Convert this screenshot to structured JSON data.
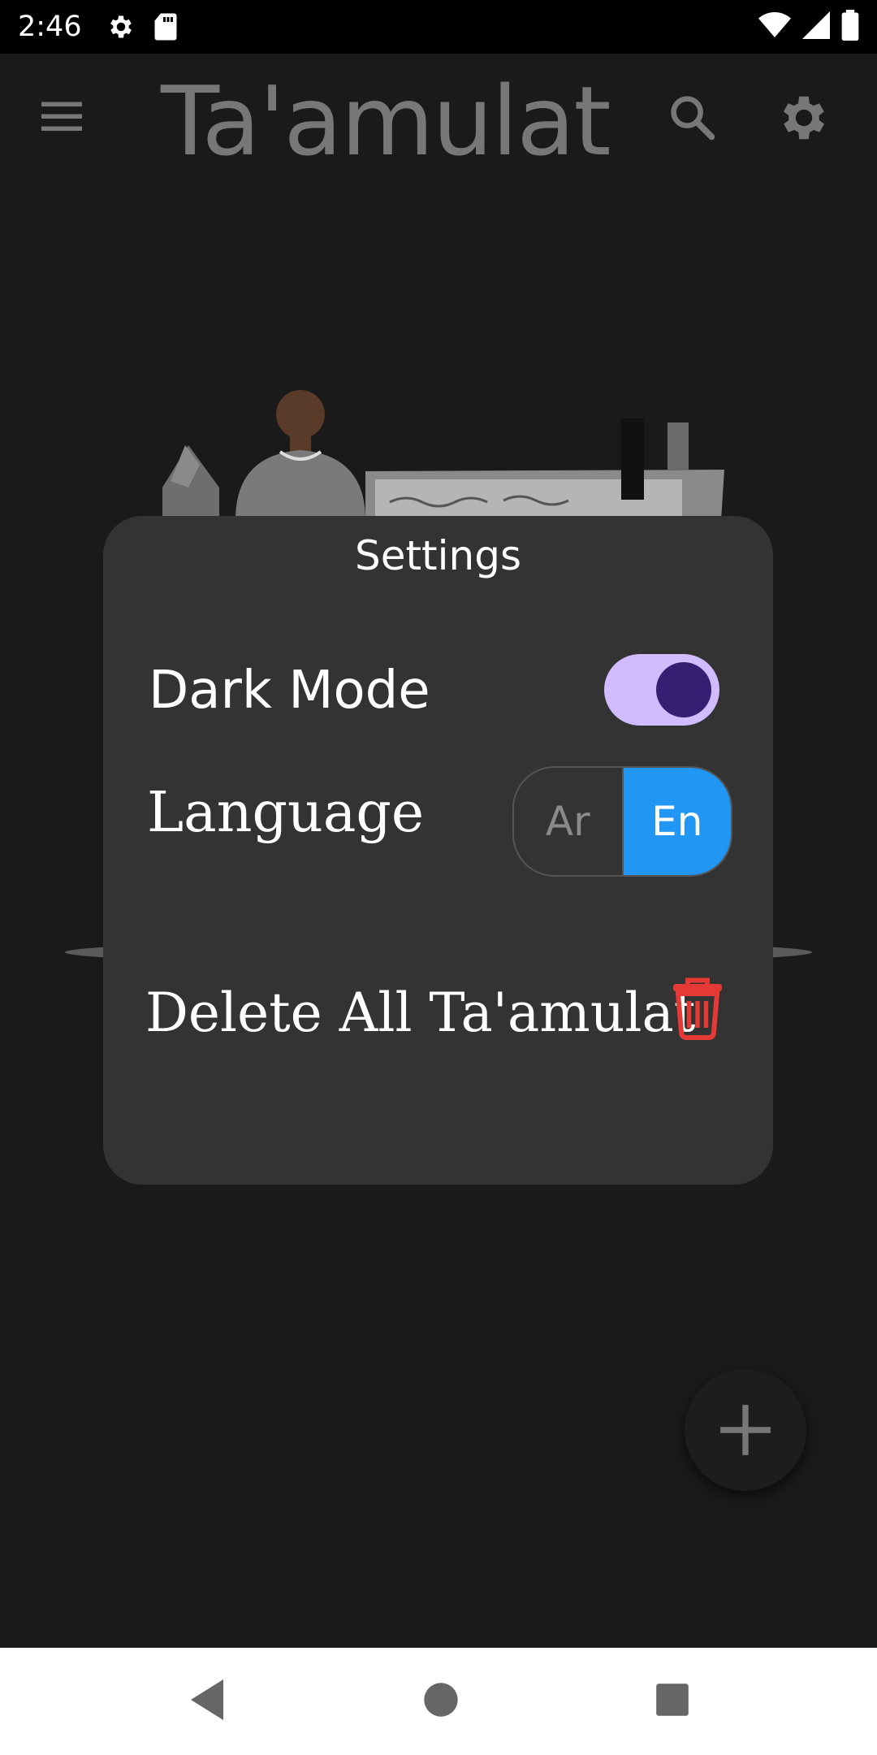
{
  "status_bar": {
    "time": "2:46",
    "icons": [
      "gear-icon",
      "sd-card-icon",
      "wifi-icon",
      "signal-icon",
      "battery-icon"
    ]
  },
  "app_bar": {
    "title": "Ta'amulat",
    "icons": [
      "menu-icon",
      "search-icon",
      "settings-icon"
    ]
  },
  "settings_dialog": {
    "title": "Settings",
    "dark_mode": {
      "label": "Dark Mode",
      "enabled": true
    },
    "language": {
      "label": "Language",
      "options": [
        "Ar",
        "En"
      ],
      "selected": "En"
    },
    "delete_all": {
      "label": "Delete All Ta'amulat",
      "icon": "trash-icon"
    }
  },
  "fab": {
    "icon": "plus-icon"
  },
  "nav_bar": {
    "icons": [
      "back-icon",
      "home-icon",
      "recents-icon"
    ]
  },
  "colors": {
    "background": "#1a1a1a",
    "dialog": "#333333",
    "switch_track": "#d0bcff",
    "switch_knob": "#381e72",
    "selected_language": "#2196f3",
    "delete_icon": "#e53935"
  }
}
